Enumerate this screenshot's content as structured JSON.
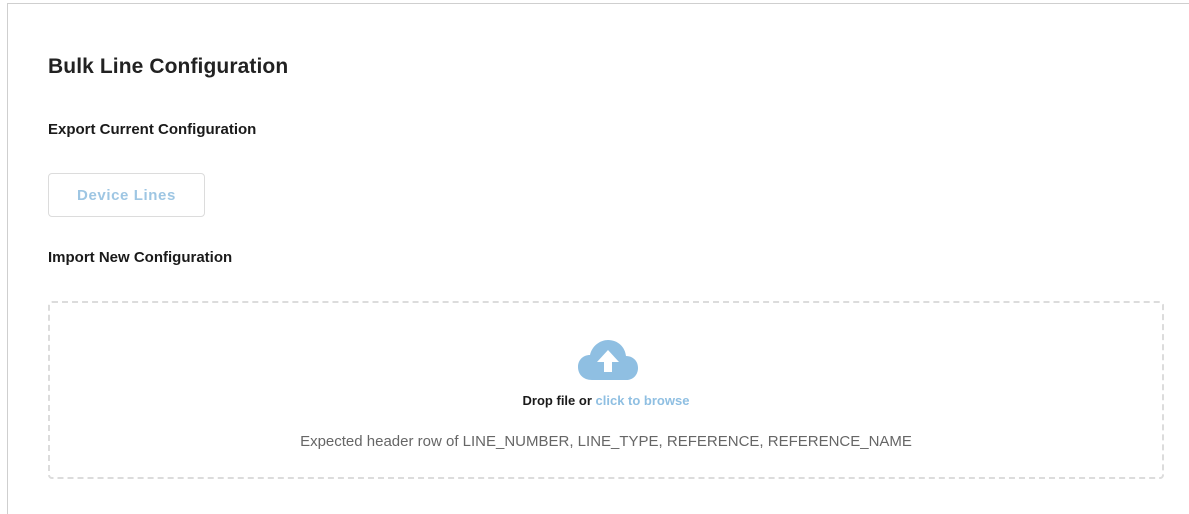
{
  "page": {
    "title": "Bulk Line Configuration"
  },
  "export": {
    "title": "Export Current Configuration",
    "device_lines_label": "Device Lines"
  },
  "import": {
    "title": "Import New Configuration",
    "drop_text": "Drop file or",
    "browse_text": "click to browse",
    "hint": "Expected header row of LINE_NUMBER, LINE_TYPE, REFERENCE, REFERENCE_NAME",
    "icon": "cloud-upload-icon"
  },
  "colors": {
    "accent": "#8fbfe2",
    "border": "#dcdcdc",
    "text": "#1a1a1a",
    "muted": "#666666"
  }
}
